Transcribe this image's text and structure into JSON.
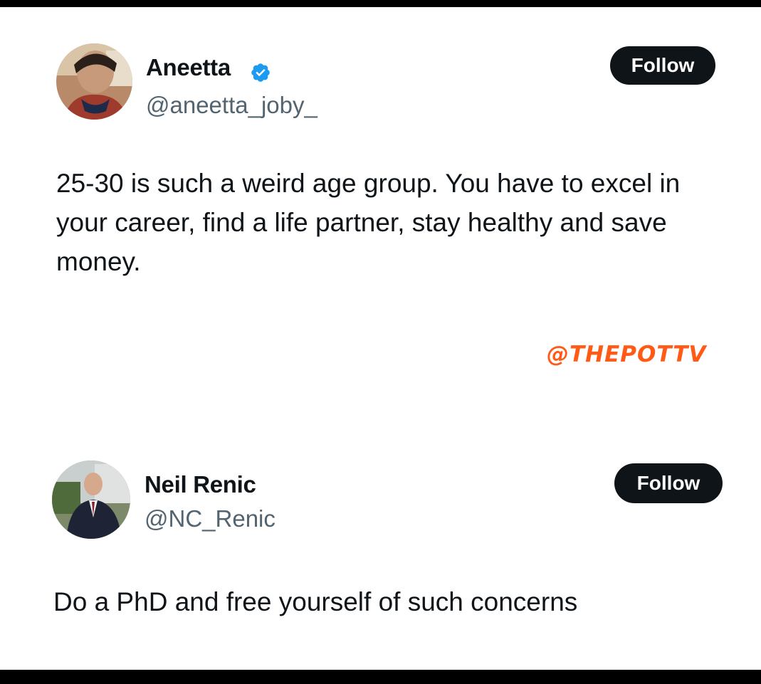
{
  "colors": {
    "accent": "#1d9bf0",
    "button_bg": "#0f1419",
    "handle": "#536471",
    "watermark": "#ff5a16"
  },
  "post1": {
    "name": "Aneetta",
    "handle": "@aneetta_joby_",
    "verified": true,
    "follow_label": "Follow",
    "text": "25-30 is such a weird age group. You have to excel in your career, find a life partner, stay healthy and save money."
  },
  "watermark": "@THEPOTTV",
  "post2": {
    "name": "Neil Renic",
    "handle": "@NC_Renic",
    "follow_label": "Follow",
    "text": "Do a PhD and free yourself of such concerns"
  }
}
